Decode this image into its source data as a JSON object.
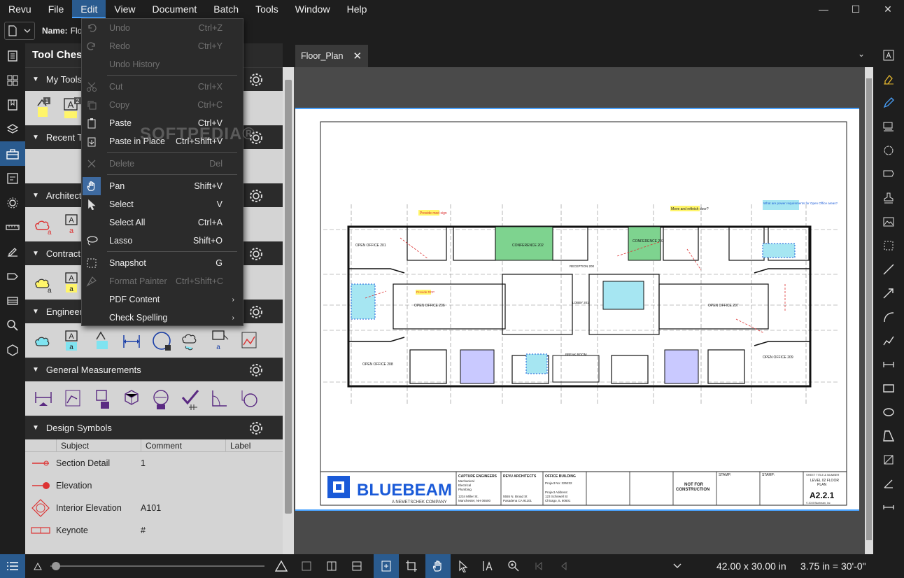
{
  "menubar": {
    "items": [
      "Revu",
      "File",
      "Edit",
      "View",
      "Document",
      "Batch",
      "Tools",
      "Window",
      "Help"
    ],
    "active": "Edit"
  },
  "window": {
    "minimize": "—",
    "maximize": "☐",
    "close": "✕"
  },
  "namebar": {
    "label": "Name:",
    "value": "Flo"
  },
  "toolchest": {
    "title": "Tool Chest",
    "sections": {
      "my_tools": "My Tools",
      "recent": "Recent To",
      "architect": "Architect",
      "contract": "Contract",
      "engineer": "Engineer",
      "general": "General Measurements",
      "design": "Design Symbols"
    },
    "badges": {
      "a": "1",
      "b": "2"
    },
    "glyph_a": "A",
    "glyph_small_a": "a",
    "symbols_headers": {
      "subject": "Subject",
      "comment": "Comment",
      "label": "Label"
    },
    "symbols": [
      {
        "subject": "Section Detail",
        "comment": "1"
      },
      {
        "subject": "Elevation",
        "comment": ""
      },
      {
        "subject": "Interior Elevation",
        "comment": "A101"
      },
      {
        "subject": "Keynote",
        "comment": "#"
      }
    ]
  },
  "tab": {
    "name": "Floor_Plan"
  },
  "editmenu": {
    "undo": {
      "label": "Undo",
      "shortcut": "Ctrl+Z"
    },
    "redo": {
      "label": "Redo",
      "shortcut": "Ctrl+Y"
    },
    "history": {
      "label": "Undo History"
    },
    "cut": {
      "label": "Cut",
      "shortcut": "Ctrl+X"
    },
    "copy": {
      "label": "Copy",
      "shortcut": "Ctrl+C"
    },
    "paste": {
      "label": "Paste",
      "shortcut": "Ctrl+V"
    },
    "paste_in_place": {
      "label": "Paste in Place",
      "shortcut": "Ctrl+Shift+V"
    },
    "delete": {
      "label": "Delete",
      "shortcut": "Del"
    },
    "pan": {
      "label": "Pan",
      "shortcut": "Shift+V"
    },
    "select": {
      "label": "Select",
      "shortcut": "V"
    },
    "select_all": {
      "label": "Select All",
      "shortcut": "Ctrl+A"
    },
    "lasso": {
      "label": "Lasso",
      "shortcut": "Shift+O"
    },
    "snapshot": {
      "label": "Snapshot",
      "shortcut": "G"
    },
    "format_painter": {
      "label": "Format Painter",
      "shortcut": "Ctrl+Shift+C"
    },
    "pdf_content": {
      "label": "PDF Content"
    },
    "check_spelling": {
      "label": "Check Spelling"
    }
  },
  "watermark": "SOFTPEDIA®",
  "drawing": {
    "logo": "BLUEBEAM",
    "logo_sub": "A NEMETSCHEK COMPANY",
    "block1": {
      "title": "CAPTURE ENGINEERS",
      "l1": "Mechanical",
      "l2": "Electrical",
      "l3": "Plumbing",
      "l4": "1234 Miller St.",
      "l5": "Manchester, NH 06500"
    },
    "block2": {
      "title": "REVU ARCHITECTS",
      "l1": "5555 N. Broad St",
      "l2": "Pasadena CA 91101"
    },
    "block3": {
      "title": "OFFICE BUILDING",
      "l1": "Project No: 325232",
      "l2": "Project Address:",
      "l3": "123 Schirwell St",
      "l4": "Chicago, IL 60601"
    },
    "not_for": "NOT FOR",
    "construction": "CONSTRUCTION",
    "stamp1": "STAMP:",
    "stamp2": "STAMP:",
    "sheet_title_hdr": "SHEET TITLE & NUMBER",
    "sheet_title": "LEVEL 02 FLOOR",
    "sheet_title2": "PLAN",
    "sheet_no": "A2.2.1",
    "copyright": "© 2019 Bluebeam, Inc",
    "callouts": {
      "provide_mod": "Provide mod sign",
      "move_door": "Move and refinish door?",
      "what_are_power": "What are power requirements for Open Office areas?",
      "conference": "CONFERENCE 202",
      "conference2": "CONFERENCE 203",
      "open_office_201": "OPEN OFFICE 201",
      "open_office_206": "OPEN OFFICE 206",
      "open_office_207": "OPEN OFFICE 207",
      "open_office_208": "OPEN OFFICE 208",
      "open_office_209": "OPEN OFFICE 209",
      "provide_rcp": "Provide RCP",
      "reception": "RECEPTION 200",
      "lobby": "LOBBY 201",
      "break_room": "BREAK ROOM"
    }
  },
  "status": {
    "dims": "42.00 x 30.00 in",
    "scale": "3.75 in = 30'-0\""
  },
  "colors": {
    "accent": "#2a5b8f",
    "highlight": "#4aa3ff",
    "panel": "#d4d4d4",
    "menu": "#2b2b2b"
  }
}
